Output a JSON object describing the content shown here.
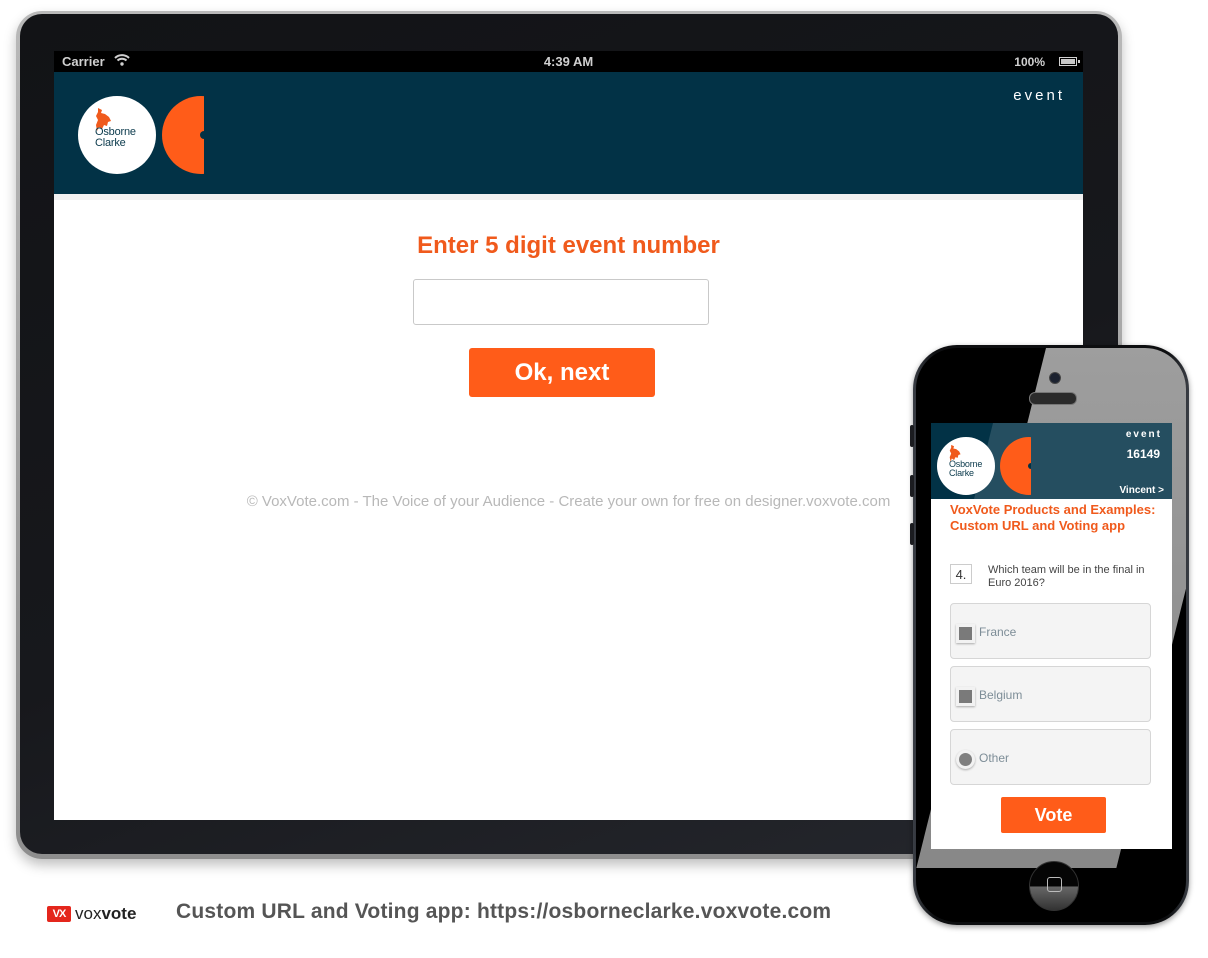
{
  "tablet": {
    "statusbar": {
      "carrier": "Carrier",
      "wifi_icon": "wifi-icon",
      "time": "4:39 AM",
      "battery_percent": "100%",
      "battery_icon": "battery-icon"
    },
    "header": {
      "logo_line1": "Osborne",
      "logo_line2": "Clarke",
      "event_label": "event"
    },
    "main": {
      "prompt": "Enter 5 digit event number",
      "event_input_value": "",
      "event_input_placeholder": "",
      "ok_button_label": "Ok, next",
      "footer_credit": "© VoxVote.com - The Voice of your Audience - Create your own for free on designer.voxvote.com"
    }
  },
  "phone": {
    "header": {
      "logo_line1": "Osborne",
      "logo_line2": "Clarke",
      "event_label": "event",
      "event_number": "16149",
      "user": "Vincent  >"
    },
    "event_title": "VoxVote Products and Examples: Custom URL and Voting app",
    "question": {
      "number": "4.",
      "text": "Which team will be in the final in Euro 2016?",
      "options": [
        {
          "label": "France",
          "type": "checkbox"
        },
        {
          "label": "Belgium",
          "type": "checkbox"
        },
        {
          "label": "Other",
          "type": "radio"
        }
      ]
    },
    "vote_button_label": "Vote"
  },
  "caption": {
    "brand_icon": "VX",
    "brand_light": "vox",
    "brand_bold": "vote",
    "text": "Custom URL and Voting app: https://osborneclarke.voxvote.com"
  },
  "colors": {
    "accent": "#ff5c19",
    "header_bg": "#023246",
    "prompt_text": "#f05a1c"
  }
}
